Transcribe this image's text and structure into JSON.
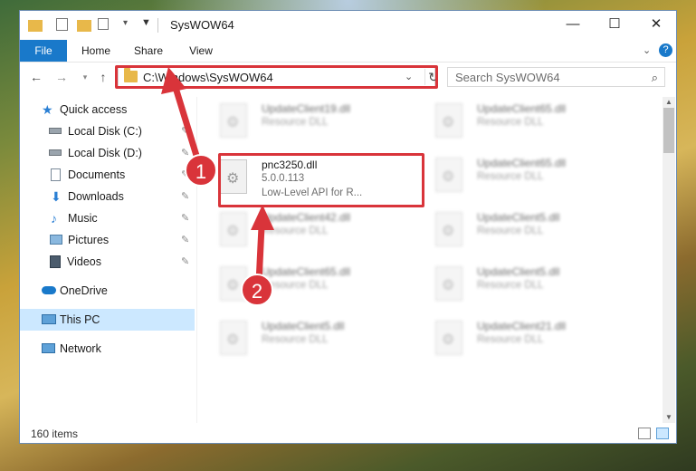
{
  "window": {
    "title": "SysWOW64"
  },
  "ribbon": {
    "tabs": [
      "File",
      "Home",
      "Share",
      "View"
    ]
  },
  "address": {
    "path": "C:\\Windows\\SysWOW64",
    "search_placeholder": "Search SysWOW64"
  },
  "nav": {
    "items": [
      {
        "label": "Quick access",
        "icon": "star-icon"
      },
      {
        "label": "Local Disk (C:)",
        "icon": "drive-icon"
      },
      {
        "label": "Local Disk (D:)",
        "icon": "drive-icon"
      },
      {
        "label": "Documents",
        "icon": "documents-icon"
      },
      {
        "label": "Downloads",
        "icon": "download-icon"
      },
      {
        "label": "Music",
        "icon": "music-icon"
      },
      {
        "label": "Pictures",
        "icon": "pictures-icon"
      },
      {
        "label": "Videos",
        "icon": "videos-icon"
      },
      {
        "label": "OneDrive",
        "icon": "cloud-icon"
      },
      {
        "label": "This PC",
        "icon": "computer-icon"
      },
      {
        "label": "Network",
        "icon": "network-icon"
      }
    ]
  },
  "files": {
    "highlighted": {
      "name": "pnc3250.dll",
      "version": "5.0.0.113",
      "description": "Low-Level API for R..."
    },
    "blurred": [
      {
        "name": "UpdateClient19.dll",
        "type": "Resource DLL"
      },
      {
        "name": "UpdateClient65.dll",
        "type": "Resource DLL"
      },
      {
        "name": "UpdateClient65.dll",
        "type": "Resource DLL"
      },
      {
        "name": "UpdateClient42.dll",
        "type": "Resource DLL"
      },
      {
        "name": "UpdateClient5.dll",
        "type": "Resource DLL"
      },
      {
        "name": "UpdateClient65.dll",
        "type": "Resource DLL"
      },
      {
        "name": "UpdateClient5.dll",
        "type": "Resource DLL"
      },
      {
        "name": "UpdateClient5.dll",
        "type": "Resource DLL"
      },
      {
        "name": "UpdateClient21.dll",
        "type": "Resource DLL"
      }
    ]
  },
  "status": {
    "item_count": "160 items"
  },
  "annotations": {
    "badge1": "1",
    "badge2": "2",
    "color": "#d9343a"
  }
}
